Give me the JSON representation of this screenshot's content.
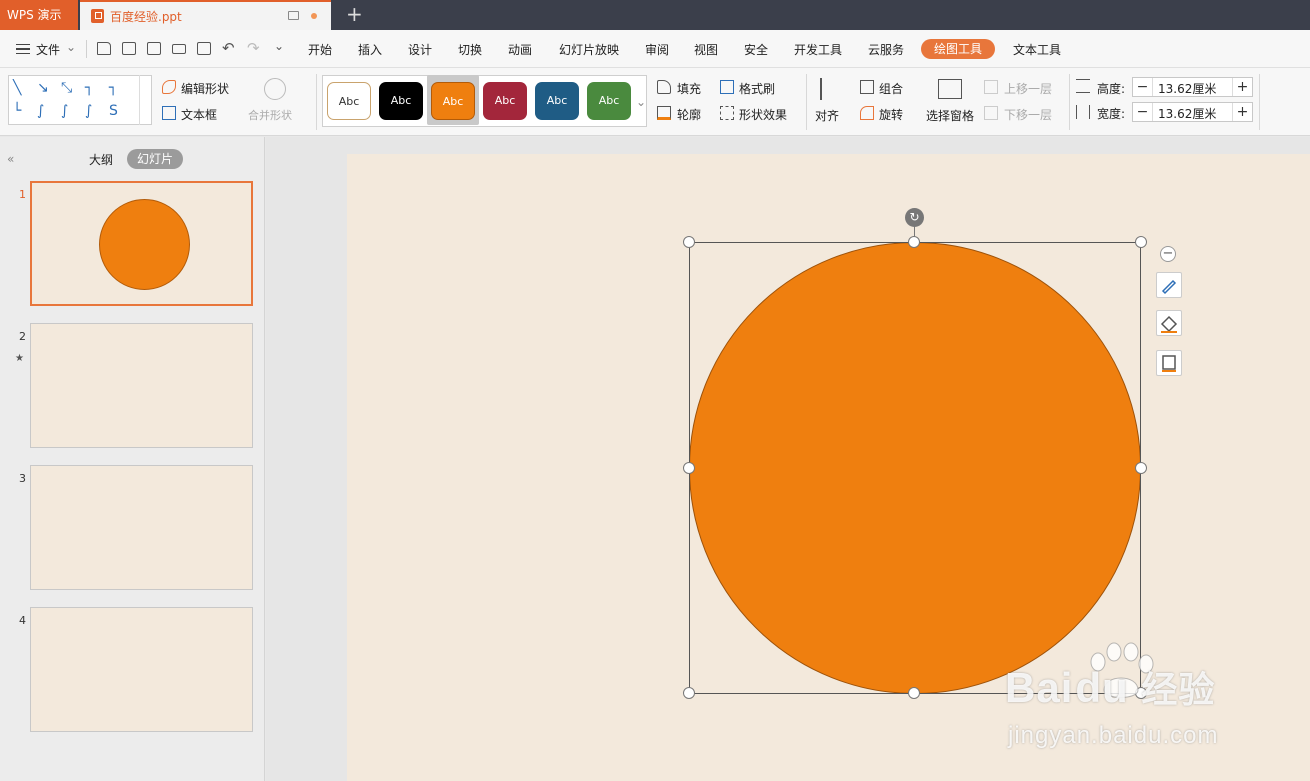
{
  "titlebar": {
    "app_tab": "WPS 演示",
    "doc_tab": "百度经验.ppt",
    "new_tab": "+"
  },
  "menubar": {
    "file": "文件",
    "tabs": [
      "开始",
      "插入",
      "设计",
      "切换",
      "动画",
      "幻灯片放映",
      "审阅",
      "视图",
      "安全",
      "开发工具",
      "云服务",
      "绘图工具",
      "文本工具"
    ],
    "active_tab": "绘图工具"
  },
  "ribbon": {
    "edit_shape": "编辑形状",
    "text_box": "文本框",
    "merge_shapes": "合并形状",
    "style_swatches": [
      {
        "label": "Abc",
        "bg": "#ffffff",
        "fg": "#333333",
        "border": "#c9a36d"
      },
      {
        "label": "Abc",
        "bg": "#000000",
        "fg": "#ffffff",
        "border": "#000000"
      },
      {
        "label": "Abc",
        "bg": "#ef7f0f",
        "fg": "#ffffff",
        "border": "#b35b08"
      },
      {
        "label": "Abc",
        "bg": "#a3263b",
        "fg": "#ffffff",
        "border": "#a3263b"
      },
      {
        "label": "Abc",
        "bg": "#1f5c85",
        "fg": "#ffffff",
        "border": "#1f5c85"
      },
      {
        "label": "Abc",
        "bg": "#4a8a3e",
        "fg": "#ffffff",
        "border": "#4a8a3e"
      }
    ],
    "fill": "填充",
    "format_painter": "格式刷",
    "outline": "轮廓",
    "shape_effect": "形状效果",
    "align": "对齐",
    "group": "组合",
    "rotate": "旋转",
    "selection_pane": "选择窗格",
    "bring_forward": "上移一层",
    "send_backward": "下移一层",
    "height_label": "高度:",
    "height_value": "13.62厘米",
    "width_label": "宽度:",
    "width_value": "13.62厘米"
  },
  "panel": {
    "outline_tab": "大纲",
    "slides_tab": "幻灯片",
    "slide_numbers": [
      "1",
      "2",
      "3",
      "4"
    ]
  },
  "watermark": {
    "brand": "Bai",
    "brand2": "du",
    "cn": "经验",
    "url": "jingyan.baidu.com"
  },
  "colors": {
    "accent": "#e15f2a",
    "shape_fill": "#ef7f0f",
    "slide_bg": "#f3e9dc"
  }
}
